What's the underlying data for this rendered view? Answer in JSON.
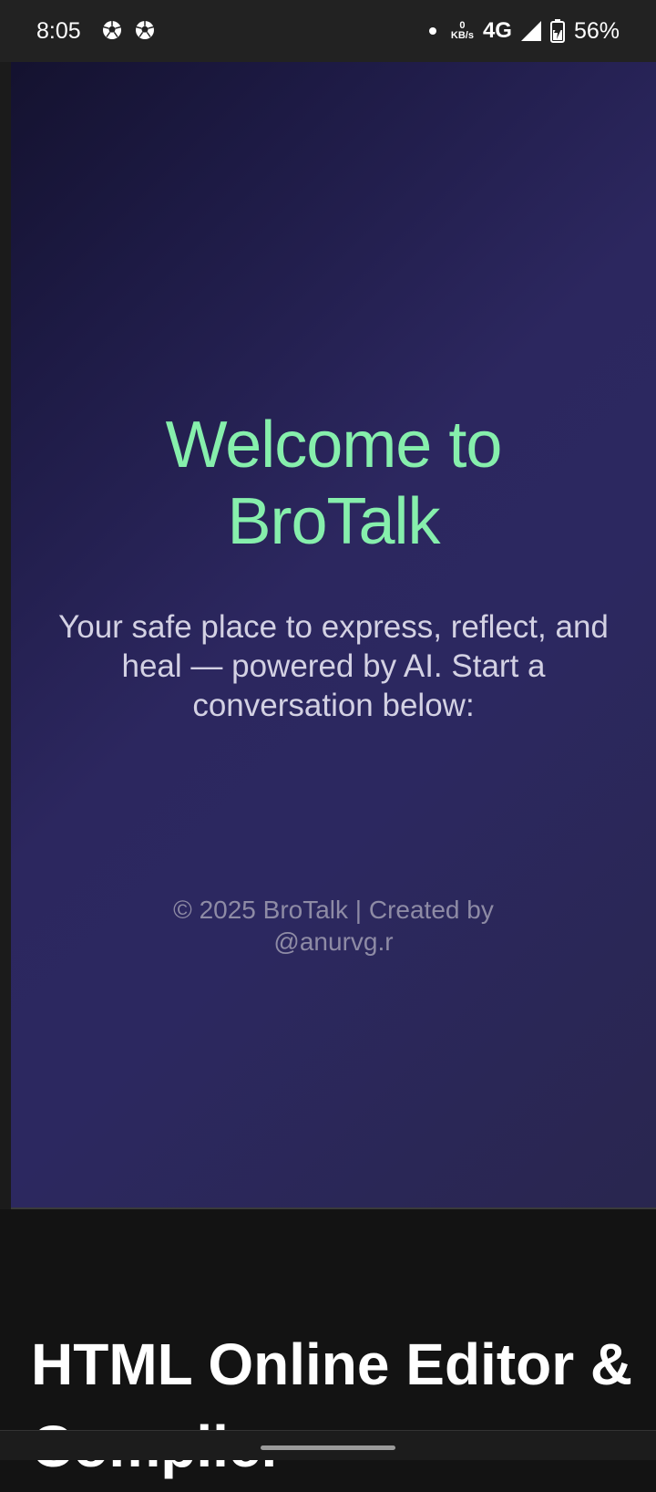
{
  "status_bar": {
    "time": "8:05",
    "notification_icons": [
      "soccer-ball-icon",
      "soccer-ball-icon"
    ],
    "net_speed_value": "0",
    "net_speed_unit": "KB/s",
    "network": "4G",
    "battery": "56%"
  },
  "preview": {
    "title_line1": "Welcome to",
    "title_line2": "BroTalk",
    "subtitle": "Your safe place to express, reflect, and heal — powered by AI. Start a conversation below:",
    "footer_line1": "© 2025 BroTalk | Created by",
    "footer_line2": "@anurvg.r",
    "accent_color": "#86efac"
  },
  "page": {
    "heading_line1": "HTML Online Editor &",
    "heading_line2": "Compiler"
  }
}
